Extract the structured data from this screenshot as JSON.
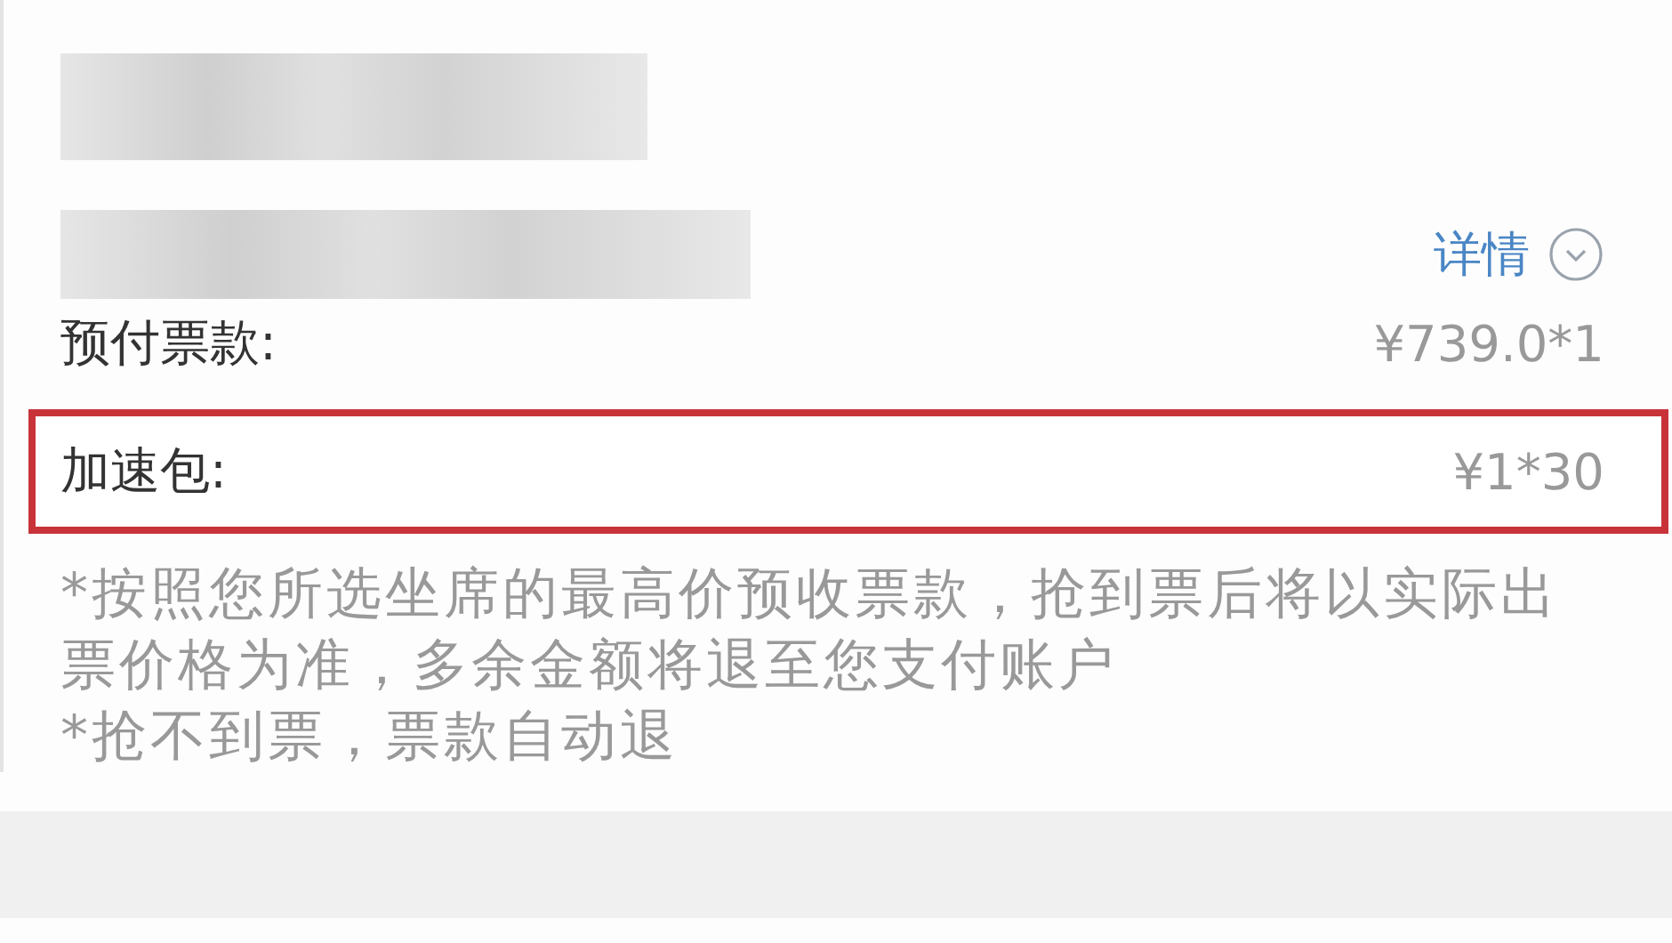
{
  "details_link": {
    "label": "详情"
  },
  "price_rows": [
    {
      "label": "预付票款:",
      "value": "¥739.0*1",
      "highlighted": false
    },
    {
      "label": "加速包:",
      "value": "¥1*30",
      "highlighted": true
    }
  ],
  "notes": [
    "*按照您所选坐席的最高价预收票款，抢到票后将以实际出票价格为准，多余金额将退至您支付账户",
    "*抢不到票，票款自动退"
  ]
}
